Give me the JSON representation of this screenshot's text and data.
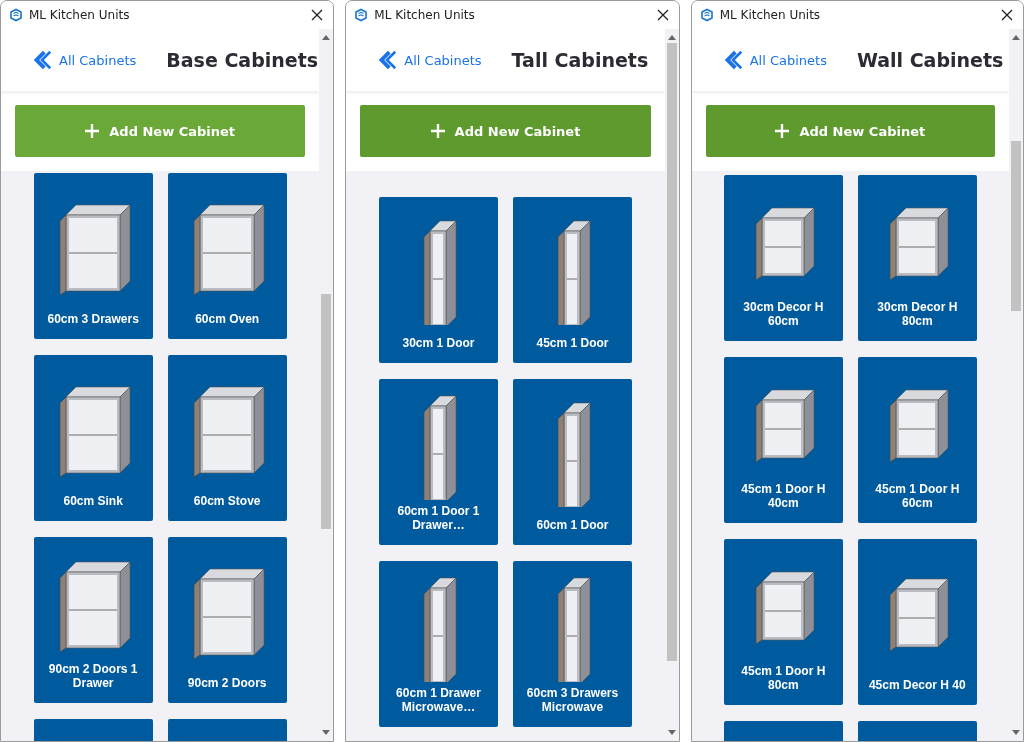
{
  "windows": [
    {
      "title": "ML Kitchen Units",
      "back_link": "All Cabinets",
      "heading": "Base Cabinets",
      "add_button": {
        "label": "Add New Cabinet",
        "hovered": true
      },
      "cabinets": [
        {
          "kind": "tile",
          "label": "60cm 3 Drawers"
        },
        {
          "kind": "tile",
          "label": "60cm Oven"
        },
        {
          "kind": "tile",
          "label": "60cm Sink"
        },
        {
          "kind": "tile",
          "label": "60cm Stove"
        },
        {
          "kind": "tile",
          "label": "90cm 2 Doors 1 Drawer"
        },
        {
          "kind": "tile",
          "label": "90cm 2 Doors"
        },
        {
          "kind": "cut"
        },
        {
          "kind": "cut"
        }
      ]
    },
    {
      "title": "ML Kitchen Units",
      "back_link": "All Cabinets",
      "heading": "Tall Cabinets",
      "add_button": {
        "label": "Add New Cabinet",
        "hovered": false
      },
      "cabinets": [
        {
          "kind": "tile",
          "label": "30cm 1 Door"
        },
        {
          "kind": "tile",
          "label": "45cm 1 Door"
        },
        {
          "kind": "tile",
          "label": "60cm 1 Door 1 Drawer…"
        },
        {
          "kind": "tile",
          "label": "60cm 1 Door"
        },
        {
          "kind": "tile",
          "label": "60cm 1 Drawer Microwave…"
        },
        {
          "kind": "tile",
          "label": "60cm 3 Drawers Microwave"
        }
      ]
    },
    {
      "title": "ML Kitchen Units",
      "back_link": "All Cabinets",
      "heading": "Wall Cabinets",
      "add_button": {
        "label": "Add New Cabinet",
        "hovered": false
      },
      "cabinets": [
        {
          "kind": "tile",
          "label": "30cm Decor H 60cm"
        },
        {
          "kind": "tile",
          "label": "30cm Decor H 80cm"
        },
        {
          "kind": "tile",
          "label": "45cm 1 Door H 40cm"
        },
        {
          "kind": "tile",
          "label": "45cm 1 Door H 60cm"
        },
        {
          "kind": "tile",
          "label": "45cm 1 Door H 80cm"
        },
        {
          "kind": "tile",
          "label": "45cm Decor H 40"
        },
        {
          "kind": "cut"
        },
        {
          "kind": "cut"
        }
      ]
    }
  ]
}
